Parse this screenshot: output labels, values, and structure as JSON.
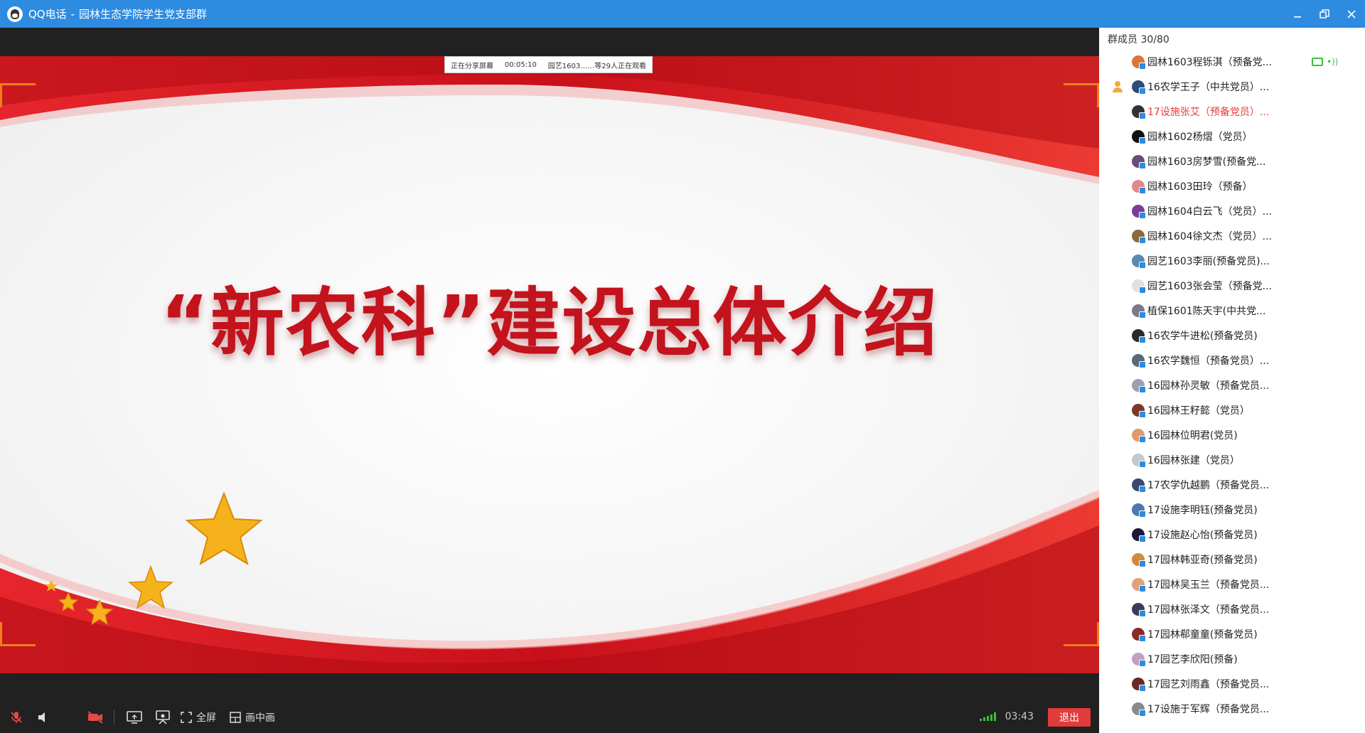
{
  "window": {
    "app_name": "QQ电话",
    "separator": "-",
    "group_name": "园林生态学院学生党支部群",
    "minimize_icon": "minimize-icon",
    "restore_icon": "restore-icon",
    "close_icon": "close-icon"
  },
  "share_bar": {
    "status": "正在分享屏幕",
    "elapsed": "00:05:10",
    "viewers": "园艺1603……等29人正在观看"
  },
  "slide": {
    "title": "“新农科”建设总体介绍",
    "colors": {
      "ribbon": "#d4141c",
      "title": "#c3131d",
      "star": "#f6b21a"
    }
  },
  "toolbar": {
    "fullscreen_label": "全屏",
    "pip_label": "画中画",
    "time": "03:43",
    "exit_label": "退出",
    "signal_color": "#3cbf3c",
    "exit_color": "#e23b3b"
  },
  "members_panel": {
    "title": "群成员 30/80",
    "members": [
      {
        "name": "园林1603程铄淇（预备党...",
        "avatar": "#d9773a",
        "sharing": true
      },
      {
        "name": "16农学王子（中共党员）...",
        "avatar": "#2c4c7a",
        "host": true
      },
      {
        "name": "17设施张艾（预备党员）...",
        "avatar": "#333333",
        "speaking": true
      },
      {
        "name": "园林1602杨熠（党员）",
        "avatar": "#111111"
      },
      {
        "name": "园林1603房梦雪(预备党...",
        "avatar": "#6a4c7a"
      },
      {
        "name": "园林1603田玲（预备）",
        "avatar": "#e08a8a"
      },
      {
        "name": "园林1604白云飞（党员）...",
        "avatar": "#7a3c9a"
      },
      {
        "name": "园林1604徐文杰（党员）...",
        "avatar": "#8a6a3a"
      },
      {
        "name": "园艺1603李丽(预备党员)...",
        "avatar": "#5a8ab0"
      },
      {
        "name": "园艺1603张会莹（预备党...",
        "avatar": "#e0e0e0"
      },
      {
        "name": "植保1601陈天宇(中共党...",
        "avatar": "#7a7a8a"
      },
      {
        "name": "16农学牛进松(预备党员)",
        "avatar": "#2a2a2a"
      },
      {
        "name": "16农学魏恒（预备党员）...",
        "avatar": "#5a6a7a"
      },
      {
        "name": "16园林孙灵敏（预备党员...",
        "avatar": "#9aa0b0"
      },
      {
        "name": "16园林王籽懿（党员）",
        "avatar": "#7a3a2a"
      },
      {
        "name": "16园林位明君(党员)",
        "avatar": "#e09a6a"
      },
      {
        "name": "16园林张建（党员）",
        "avatar": "#c0c8d0"
      },
      {
        "name": "17农学仇越鹏（预备党员...",
        "avatar": "#3a4a6a"
      },
      {
        "name": "17设施李明钰(预备党员)",
        "avatar": "#4a7ab0"
      },
      {
        "name": "17设施赵心怡(预备党员)",
        "avatar": "#1a1a3a"
      },
      {
        "name": "17园林韩亚奇(预备党员)",
        "avatar": "#d08a3a"
      },
      {
        "name": "17园林吴玉兰（预备党员...",
        "avatar": "#e0a07a"
      },
      {
        "name": "17园林张泽文（预备党员...",
        "avatar": "#3a3a5a"
      },
      {
        "name": "17园林郗童童(预备党员)",
        "avatar": "#8a2a2a"
      },
      {
        "name": "17园艺李欣阳(预备)",
        "avatar": "#c0a0c0"
      },
      {
        "name": "17园艺刘雨鑫（预备党员...",
        "avatar": "#6a2a2a"
      },
      {
        "name": "17设施于军辉（预备党员...",
        "avatar": "#8a8a8a"
      }
    ]
  }
}
